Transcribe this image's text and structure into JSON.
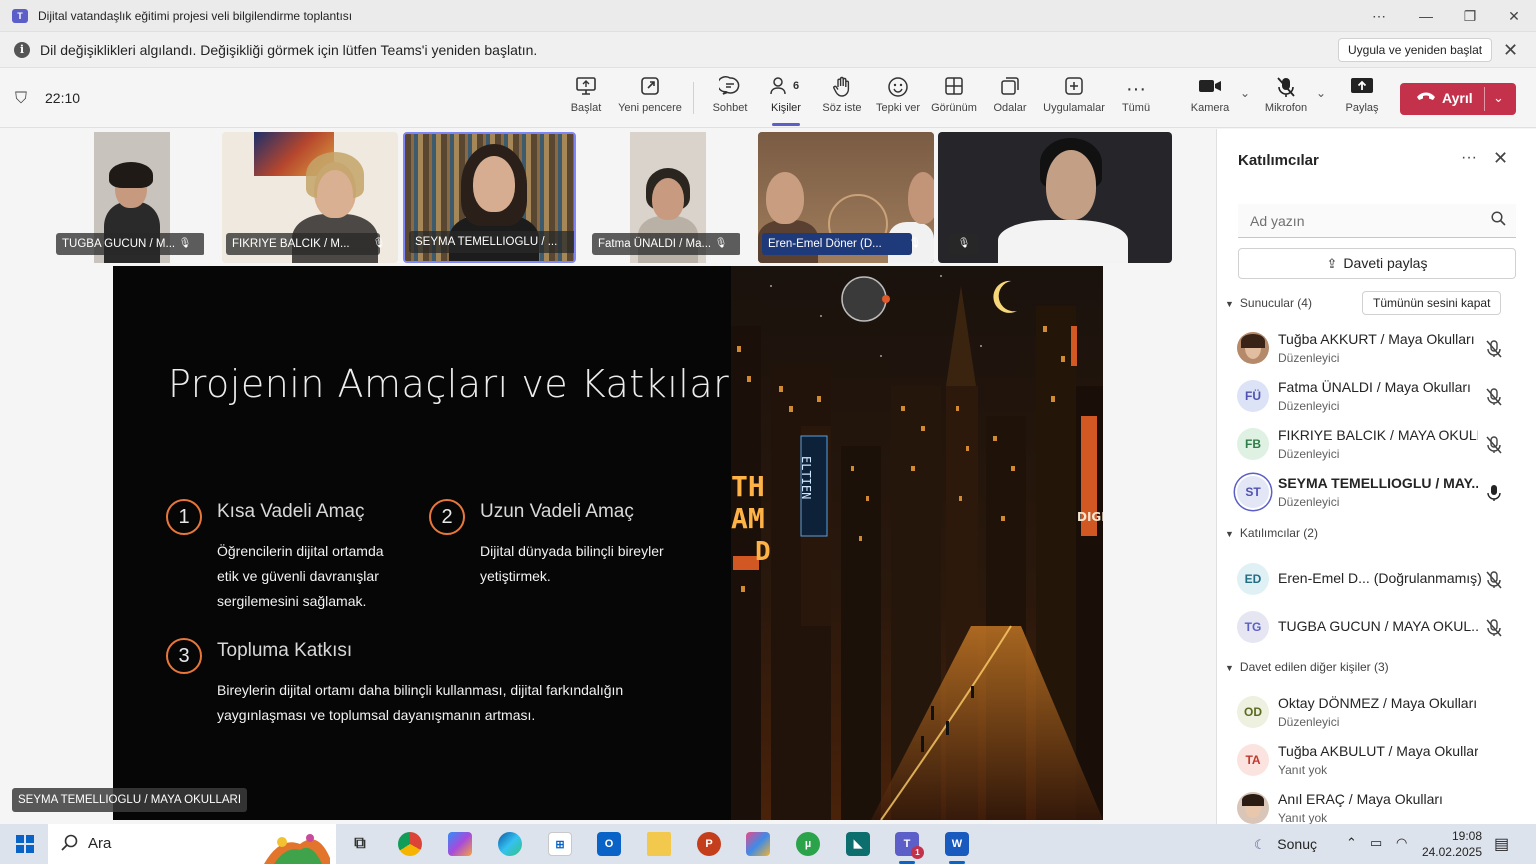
{
  "window": {
    "title": "Dijital vatandaşlık eğitimi projesi veli bilgilendirme toplantısı",
    "app_icon": "T"
  },
  "notice": {
    "message": "Dil değişiklikleri algılandı. Değişikliği görmek için lütfen Teams'i yeniden başlatın.",
    "apply_label": "Uygula ve yeniden başlat"
  },
  "toolbar": {
    "timer": "22:10",
    "buttons": [
      {
        "label": "Başlat",
        "icon": "present-icon"
      },
      {
        "label": "Yeni pencere",
        "icon": "popout-icon"
      },
      {
        "label": "Sohbet",
        "icon": "chat-icon"
      },
      {
        "label": "Kişiler",
        "icon": "people-icon",
        "count": "6"
      },
      {
        "label": "Söz iste",
        "icon": "raise-hand-icon"
      },
      {
        "label": "Tepki ver",
        "icon": "react-icon"
      },
      {
        "label": "Görünüm",
        "icon": "view-icon"
      },
      {
        "label": "Odalar",
        "icon": "rooms-icon"
      },
      {
        "label": "Uygulamalar",
        "icon": "apps-icon"
      },
      {
        "label": "Tümü",
        "icon": "more-icon"
      },
      {
        "label": "Kamera",
        "icon": "camera-icon"
      },
      {
        "label": "Mikrofon",
        "icon": "mic-off-icon"
      },
      {
        "label": "Paylaş",
        "icon": "share-icon"
      }
    ],
    "leave_label": "Ayrıl"
  },
  "tiles": [
    {
      "name": "TUGBA GUCUN / M..."
    },
    {
      "name": "FIKRIYE BALCIK / M..."
    },
    {
      "name": "SEYMA TEMELLIOGLU / ..."
    },
    {
      "name": "Fatma ÜNALDI / Ma..."
    },
    {
      "name": "Eren-Emel Döner (D..."
    },
    {
      "name": ""
    }
  ],
  "slide": {
    "title": "Projenin Amaçları ve Katkıları",
    "goals": [
      {
        "num": "1",
        "title": "Kısa Vadeli Amaç",
        "lines": [
          "Öğrencilerin dijital ortamda",
          "etik ve güvenli davranışlar",
          "sergilemesini sağlamak."
        ]
      },
      {
        "num": "2",
        "title": "Uzun Vadeli Amaç",
        "lines": [
          "Dijital dünyada bilinçli bireyler",
          "yetiştirmek."
        ]
      },
      {
        "num": "3",
        "title": "Topluma Katkısı",
        "lines": [
          "Bireylerin dijital ortamı daha bilinçli kullanması, dijital farkındalığın",
          "yaygınlaşması ve toplumsal dayanışmanın artması."
        ]
      }
    ],
    "signs": [
      "TH",
      "AM",
      "D",
      "ELTIEN",
      "DIGI"
    ]
  },
  "presenter_label": "SEYMA TEMELLIOGLU / MAYA OKULLARI",
  "panel": {
    "title": "Katılımcılar",
    "search_placeholder": "Ad yazın",
    "share_invite": "Daveti paylaş",
    "presenters_header": "Sunucular (4)",
    "mute_all": "Tümünün sesini kapat",
    "presenters": [
      {
        "initials": "",
        "name": "Tuğba AKKURT / Maya Okulları",
        "role": "Düzenleyici"
      },
      {
        "initials": "FÜ",
        "name": "Fatma ÜNALDI / Maya Okulları",
        "role": "Düzenleyici"
      },
      {
        "initials": "FB",
        "name": "FIKRIYE BALCIK / MAYA OKULL...",
        "role": "Düzenleyici"
      },
      {
        "initials": "ST",
        "name": "SEYMA TEMELLIOGLU / MAY...",
        "role": "Düzenleyici"
      }
    ],
    "attendees_header": "Katılımcılar (2)",
    "attendees": [
      {
        "initials": "ED",
        "name": "Eren-Emel D...  (Doğrulanmamış)"
      },
      {
        "initials": "TG",
        "name": "TUGBA GUCUN / MAYA OKUL..."
      }
    ],
    "invited_header": "Davet edilen diğer kişiler (3)",
    "invited": [
      {
        "initials": "OD",
        "name": "Oktay DÖNMEZ / Maya Okulları",
        "role": "Düzenleyici"
      },
      {
        "initials": "TA",
        "name": "Tuğba AKBULUT / Maya Okulları",
        "role": "Yanıt yok"
      },
      {
        "initials": "",
        "name": "Anıl ERAÇ / Maya Okulları",
        "role": "Yanıt yok"
      }
    ]
  },
  "taskbar": {
    "search_label": "Ara",
    "weather": "Sonuç",
    "time": "19:08",
    "date": "24.02.2025",
    "teams_badge": "1"
  }
}
